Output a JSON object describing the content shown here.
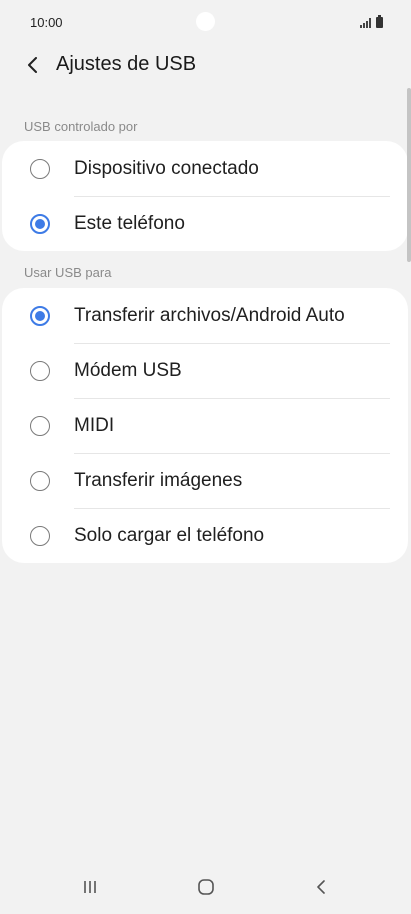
{
  "status_bar": {
    "time": "10:00",
    "icons": [
      "signal-icon",
      "battery-icon"
    ]
  },
  "header": {
    "title": "Ajustes de USB",
    "back_icon": "chevron-left-icon"
  },
  "usb_controlled_by": {
    "label": "USB controlado por",
    "options": [
      {
        "label": "Dispositivo conectado",
        "selected": false
      },
      {
        "label": "Este teléfono",
        "selected": true
      }
    ]
  },
  "use_usb_for": {
    "label": "Usar USB para",
    "options": [
      {
        "label": "Transferir archivos/Android Auto",
        "selected": true
      },
      {
        "label": "Módem USB",
        "selected": false
      },
      {
        "label": "MIDI",
        "selected": false
      },
      {
        "label": "Transferir imágenes",
        "selected": false
      },
      {
        "label": "Solo cargar el teléfono",
        "selected": false
      }
    ]
  },
  "nav_bar": {
    "buttons": [
      "recent-apps-icon",
      "home-icon",
      "back-icon"
    ]
  },
  "colors": {
    "accent": "#3e7be6",
    "background": "#f2f2f2",
    "card": "#ffffff",
    "section_label": "#8a8a8a"
  }
}
